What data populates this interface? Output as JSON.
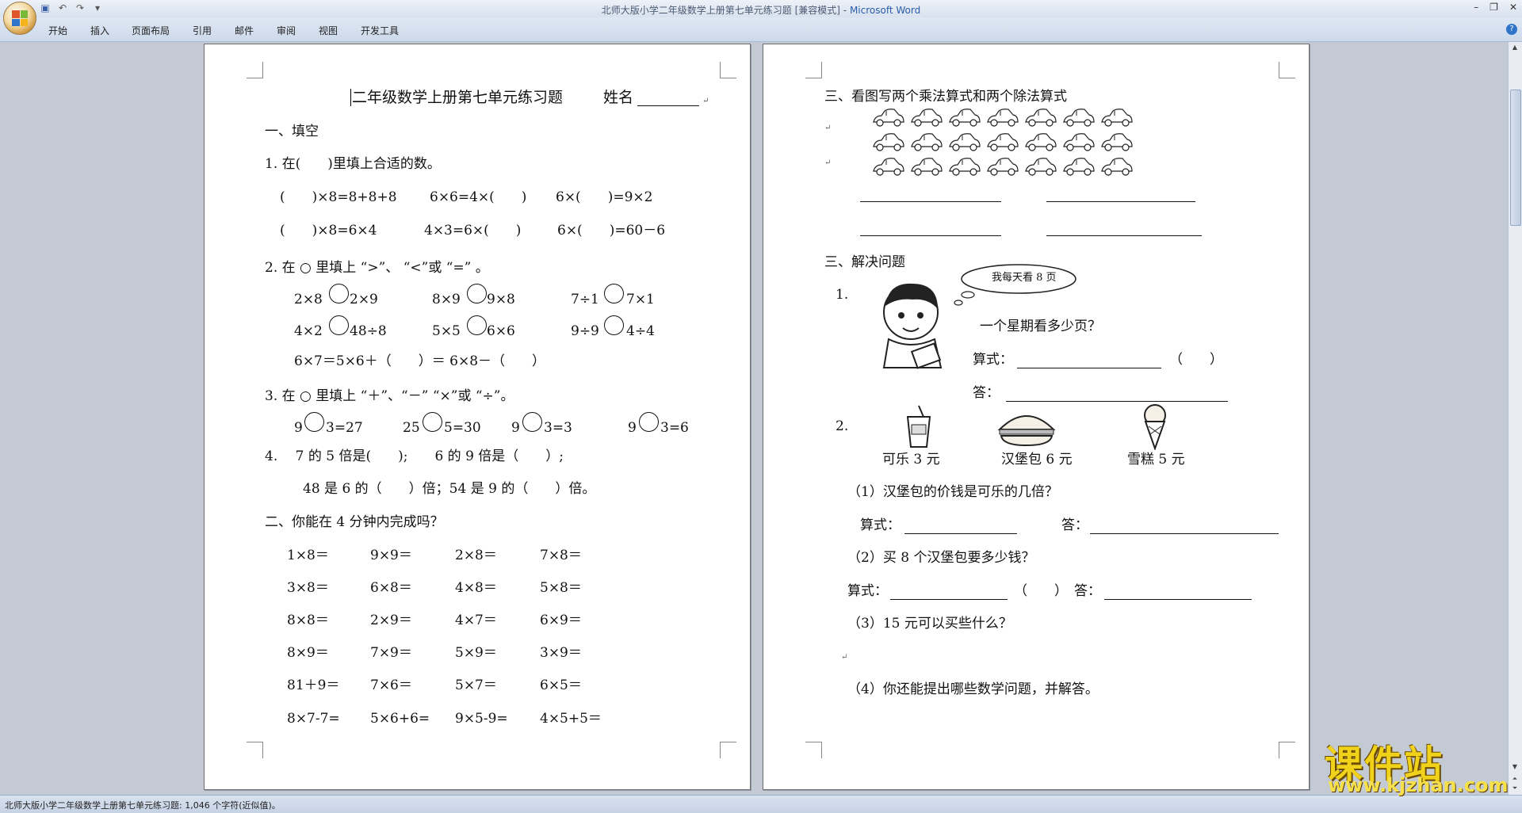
{
  "window": {
    "title": "北师大版小学二年级数学上册第七单元练习题 [兼容模式]",
    "app_name": "Microsoft Word"
  },
  "ribbon": {
    "tabs": [
      "开始",
      "插入",
      "页面布局",
      "引用",
      "邮件",
      "审阅",
      "视图",
      "开发工具"
    ]
  },
  "status_bar": {
    "text": "北师大版小学二年级数学上册第七单元练习题: 1,046 个字符(近似值)。"
  },
  "watermark": {
    "big": "课件站",
    "small": "www.kjzhan.com"
  },
  "page1": {
    "title": "二年级数学上册第七单元练习题",
    "name_label": "姓名",
    "s1_heading": "一、填空",
    "q1_text": "1. 在(　　)里填上合适的数。",
    "q1_row1": [
      "(　　)×8=8+8+8",
      "6×6=4×(　　)",
      "6×(　　)=9×2"
    ],
    "q1_row2": [
      "(　　)×8=6×4",
      "4×3=6×(　　)",
      "6×(　　)=60－6"
    ],
    "q2_text": "2. 在 ○ 里填上 “>”、 “<”或 “=” 。",
    "q2_row1": [
      "2×8",
      "2×9",
      "8×9",
      "9×8",
      "7÷1",
      "7×1"
    ],
    "q2_row2": [
      "4×2",
      "48÷8",
      "5×5",
      "6×6",
      "9÷9",
      "4÷4"
    ],
    "q2_row3": "6×7＝5×6＋（　　）＝ 6×8－（　　）",
    "q3_text": "3. 在 ○ 里填上 “＋”、“－” “×”或 “÷”。",
    "q3_row": [
      "9",
      "3=27",
      "25",
      "5=30",
      "9",
      "3=3",
      "9",
      "3=6"
    ],
    "q4_line1": "4.　 7 的 5 倍是(　　);　　6 的 9 倍是（　　）;",
    "q4_line2": "48 是 6 的（　　）倍；54 是 9 的（　　）倍。",
    "s2_heading": "二、你能在 4 分钟内完成吗？",
    "calc_rows": [
      [
        "1×8＝",
        "9×9＝",
        "2×8＝",
        "7×8＝"
      ],
      [
        "3×8＝",
        "6×8＝",
        "4×8＝",
        "5×8＝"
      ],
      [
        "8×8＝",
        "2×9＝",
        "4×7＝",
        "6×9＝"
      ],
      [
        "8×9＝",
        "7×9＝",
        "5×9＝",
        "3×9＝"
      ],
      [
        "81＋9＝",
        "7×6＝",
        "5×7＝",
        "6×5＝"
      ],
      [
        "8×7-7=",
        "5×6+6=",
        "9×5-9=",
        "4×5+5＝"
      ]
    ]
  },
  "page2": {
    "s3_heading": "三、看图写两个乘法算式和两个除法算式",
    "s4_heading": "三、解决问题",
    "p1_num": "1.",
    "speech": "我每天看 8 页",
    "p1_question": "一个星期看多少页？",
    "formula_label": "算式：",
    "answer_label": "答：",
    "paren": "（　　）",
    "p2_num": "2.",
    "items": [
      {
        "label": "可乐 3 元",
        "icon": "cola-cup-icon"
      },
      {
        "label": "汉堡包 6 元",
        "icon": "hamburger-icon"
      },
      {
        "label": "雪糕 5 元",
        "icon": "ice-cream-icon"
      }
    ],
    "sub1": "（1）汉堡包的价钱是可乐的几倍？",
    "sub2": "（2）买 8 个汉堡包要多少钱？",
    "sub3": "（3）15 元可以买些什么？",
    "sub4": "（4）你还能提出哪些数学问题，并解答。",
    "car_icon": "car-icon",
    "boy_icon": "boy-reading-icon"
  }
}
